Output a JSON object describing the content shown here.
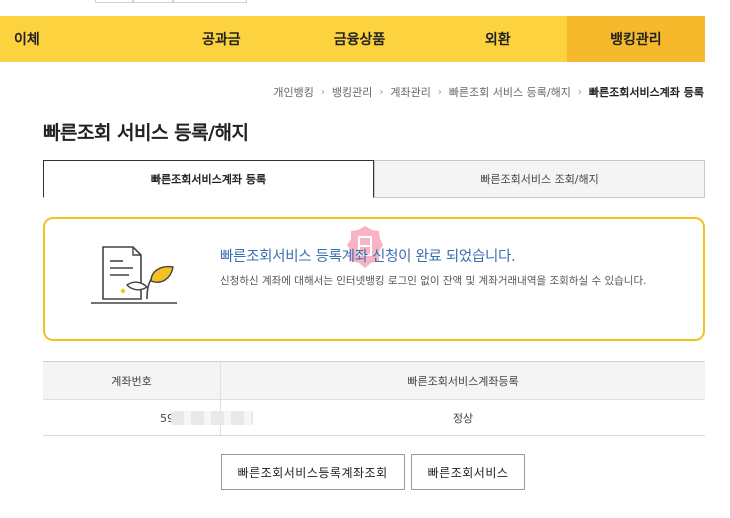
{
  "gnb": {
    "items": [
      {
        "label": "이체"
      },
      {
        "label": "공과금"
      },
      {
        "label": "금융상품"
      },
      {
        "label": "외환"
      },
      {
        "label": "뱅킹관리"
      }
    ]
  },
  "breadcrumb": {
    "items": [
      "개인뱅킹",
      "뱅킹관리",
      "계좌관리",
      "빠른조회 서비스 등록/해지"
    ],
    "current": "빠른조회서비스계좌 등록"
  },
  "page_title": "빠른조회 서비스 등록/해지",
  "tabs": [
    {
      "label": "빠른조회서비스계좌 등록",
      "active": true
    },
    {
      "label": "빠른조회서비스 조회/해지",
      "active": false
    }
  ],
  "notice": {
    "title": "빠른조회서비스 등록계좌 신청이 완료 되었습니다.",
    "description": "신청하신 계좌에 대해서는 인터넷뱅킹 로그인 없이 잔액 및 계좌거래내역을 조회하실 수 있습니다."
  },
  "table": {
    "headers": [
      "계좌번호",
      "빠른조회서비스계좌등록"
    ],
    "rows": [
      {
        "account": "59",
        "status": "정상"
      }
    ]
  },
  "buttons": {
    "inquiry": "빠른조회서비스등록계좌조회",
    "service": "빠른조회서비스"
  },
  "colors": {
    "gnb_bg": "#fdd23f",
    "gnb_active": "#f6b92b",
    "notice_border": "#f3c121",
    "notice_title": "#3a6fb0"
  }
}
